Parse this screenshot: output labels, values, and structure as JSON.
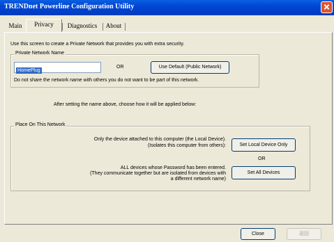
{
  "window": {
    "title": "TRENDnet Powerline Configuration Utility"
  },
  "tabs": [
    "Main",
    "Privacy",
    "Diagnostics",
    "About"
  ],
  "privacy": {
    "intro": "Use this screen to create a Private Network that provides you with extra security.",
    "private_network_group": "Private Network Name",
    "network_name_value": "HomePlug",
    "or1": "OR",
    "use_default_button": "Use Default (Public Network)",
    "warning": "Do not share the network name with others you do not want to be part of this network.",
    "after_setting": "After setting the name above, choose how it will be applied below:",
    "place_group": "Place On This Network",
    "local_line1": "Only the device attached to this computer (the Local Device).",
    "local_line2": "(Isolates this computer from others):",
    "set_local_button": "Set Local Device Only",
    "or2": "OR",
    "all_line1": "ALL devices whose Password has been entered.",
    "all_line2": "(They communicate together but are isolated from devices with",
    "all_line3": "a different network name)",
    "set_all_button": "Set All Devices"
  },
  "footer": {
    "close_button": "Close",
    "disabled_button": "返回"
  }
}
